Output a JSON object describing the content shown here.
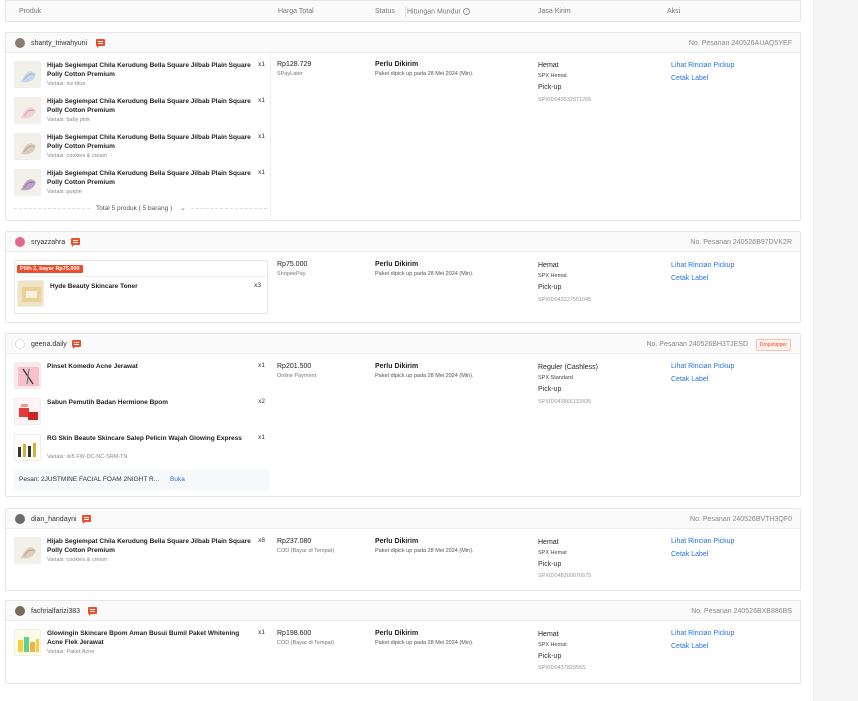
{
  "header": {
    "col_produk": "Produk",
    "col_harga": "Harga Total",
    "col_status": "Status",
    "col_hitungan": "Hitungan Mundur",
    "col_jasa": "Jasa Kirim",
    "col_aksi": "Aksi",
    "help_glyph": "?"
  },
  "orders": [
    {
      "username": "shanty_triwahyuni",
      "order_no": "No. Pesanan 240526AUAQ5YEF",
      "items": [
        {
          "name": "Hijab Segiempat Chila Kerudung Bella Square Jilbab Plain Square Polly Cotton Premium",
          "variant": "Variasi: ice blue",
          "qty": "x1"
        },
        {
          "name": "Hijab Segiempat Chila Kerudung Bella Square Jilbab Plain Square Polly Cotton Premium",
          "variant": "Variasi: baby pink",
          "qty": "x1"
        },
        {
          "name": "Hijab Segiempat Chila Kerudung Bella Square Jilbab Plain Square Polly Cotton Premium",
          "variant": "Variasi: cookies & cream",
          "qty": "x1"
        },
        {
          "name": "Hijab Segiempat Chila Kerudung Bella Square Jilbab Plain Square Polly Cotton Premium",
          "variant": "Variasi: purple",
          "qty": "x1"
        }
      ],
      "total_products": "Total 5 produk ( 5 barang )",
      "price": "Rp128.729",
      "payment": "SPayLater",
      "status": "Perlu Dikirim",
      "status_desc": "Paket dipick up pada 28 Mei 2024 (Min).",
      "ship_service": "Hemat",
      "ship_courier": "SPX Hemat",
      "ship_method": "Pick-up",
      "ship_tracking": "SPXID049532971265",
      "action_1": "Lihat Rincian Pickup",
      "action_2": "Cetak Label"
    },
    {
      "username": "sryazzahra",
      "order_no": "No. Pesanan 240526B97DVK2R",
      "promo": "Pilih 2, bayar Rp75.000",
      "items": [
        {
          "name": "Hyde Beauty Skincare Toner",
          "variant": "",
          "qty": "x3"
        }
      ],
      "price": "Rp75.000",
      "payment": "ShopeePay",
      "status": "Perlu Dikirim",
      "status_desc": "Paket dipick up pada 28 Mei 2024 (Min).",
      "ship_service": "Hemat",
      "ship_courier": "SPX Hemat",
      "ship_method": "Pick-up",
      "ship_tracking": "SPXID043227551045",
      "action_1": "Lihat Rincian Pickup",
      "action_2": "Cetak Label"
    },
    {
      "username": "geena.daily",
      "order_no": "No. Pesanan 240526BH3TJESD",
      "badge": "Dropshipper",
      "items": [
        {
          "name": "Pinset Komedo Acne Jerawat",
          "variant": "",
          "qty": "x1"
        },
        {
          "name": "Sabun Pemutih Badan Hermione Bpom",
          "variant": "",
          "qty": "x2"
        },
        {
          "name": "RG Skin Beaute Skincare Salep Pelicin Wajah Glowing Express",
          "variant": "Variasi: isi5 FW-DC-NC-SRM-TN",
          "qty": "x1"
        }
      ],
      "note_label": "Pesan: 2JUSTMINE FACIAL FOAM 2NIGHT R...",
      "note_link": "Buka",
      "price": "Rp201.500",
      "payment": "Online Payment",
      "status": "Perlu Dikirim",
      "status_desc": "Paket dipick up pada 28 Mei 2024 (Min).",
      "ship_service": "Reguler (Cashless)",
      "ship_courier": "SPX Standard",
      "ship_method": "Pick-up",
      "ship_tracking": "SPXID043866133435",
      "action_1": "Lihat Rincian Pickup",
      "action_2": "Cetak Label"
    },
    {
      "username": "dian_handayni",
      "order_no": "No. Pesanan 240526BVTH3QF0",
      "items": [
        {
          "name": "Hijab Segiempat Chila Kerudung Bella Square Jilbab Plain Square Polly Cotton Premium",
          "variant": "Variasi: cookies & cream",
          "qty": "x8"
        }
      ],
      "price": "Rp237.080",
      "payment": "COD (Bayar di Tempat)",
      "status": "Perlu Dikirim",
      "status_desc": "Paket dipick up pada 28 Mei 2024 (Min).",
      "ship_service": "Hemat",
      "ship_courier": "SPX Hemat",
      "ship_method": "Pick-up",
      "ship_tracking": "SPXID048300876675",
      "action_1": "Lihat Rincian Pickup",
      "action_2": "Cetak Label"
    },
    {
      "username": "fachrialfarizi383",
      "order_no": "No. Pesanan 240526BXB886BS",
      "items": [
        {
          "name": "Glowingin Skincare Bpom Aman Busui Bumil Paket Whitening Acne Flek Jerawat",
          "variant": "Variasi: Paket Acne",
          "qty": "x1"
        }
      ],
      "price": "Rp198.600",
      "payment": "COD (Bayar di Tempat)",
      "status": "Perlu Dikirim",
      "status_desc": "Paket dipick up pada 28 Mei 2024 (Min).",
      "ship_service": "Hemat",
      "ship_courier": "SPX Hemat",
      "ship_method": "Pick-up",
      "ship_tracking": "SPXID043782956S",
      "action_1": "Lihat Rincian Pickup",
      "action_2": "Cetak Label"
    }
  ]
}
